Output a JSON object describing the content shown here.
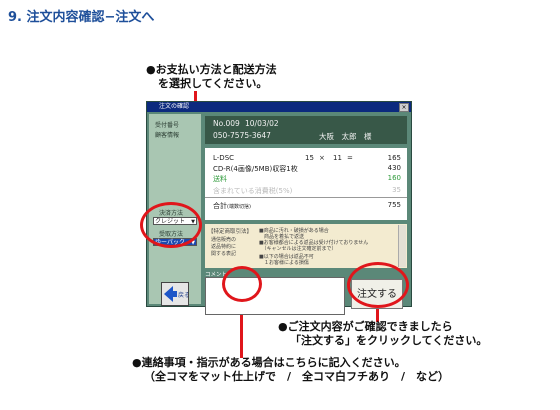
{
  "page": {
    "step_title": "9. 注文内容確認−注文へ"
  },
  "annotations": {
    "payment": [
      "●お支払い方法と配送方法",
      "を選択してください。"
    ],
    "order": [
      "●ご注文内容がご確認できましたら",
      "「注文する」をクリックしてください。"
    ],
    "comment": [
      "●連絡事項・指示がある場合はこちらに記入ください。",
      "（全コマをマット仕上げで　/　全コマ白フチあり　/　など）"
    ]
  },
  "dialog": {
    "title": "注文の確認",
    "close": "×",
    "left": {
      "receipt_label": "受付番号",
      "customer_label": "顧客情報",
      "payment_label": "決済方法",
      "payment_value": "クレジット",
      "delivery_label": "受取方法",
      "delivery_value": "ゆーパック",
      "back_label": "戻る"
    },
    "info": {
      "receipt_no": "No.009",
      "date": "10/03/02",
      "phone": "050-7575-3647",
      "name": "大阪　太郎　様"
    },
    "items": [
      {
        "label": "L-DSC",
        "qty": "15",
        "op": "×",
        "unit": "11",
        "eq": "=",
        "amount": "165"
      },
      {
        "label": "CD-R(4画像/5MB)収容1枚",
        "amount": "430"
      },
      {
        "label": "送料",
        "amount": "160"
      },
      {
        "label": "含まれている消費税(5%)",
        "amount": "35"
      },
      {
        "label": "合計",
        "sub": "(端数切捨)",
        "amount": "755"
      }
    ],
    "note": {
      "heading": "【特定商取引法】",
      "left_text": [
        "通信販売の",
        "返品特約に",
        "関する表記"
      ],
      "right_text": [
        "■商品に汚れ・破損がある場合",
        "　商品を着払で返送",
        "■お客様都合による返品は受け付けておりません",
        "　（キャンセルは注文確定前まで）",
        "■以下の場合は返品不可",
        "　１お客様による損傷"
      ]
    },
    "comment_label": "コメント",
    "comment_value": "",
    "order_button": "注文する"
  },
  "colors": {
    "annotation_red": "#e0161b",
    "title_blue": "#1e4f9a",
    "dialog_bg": "#5b8878",
    "titlebar": "#0c2a7e"
  }
}
